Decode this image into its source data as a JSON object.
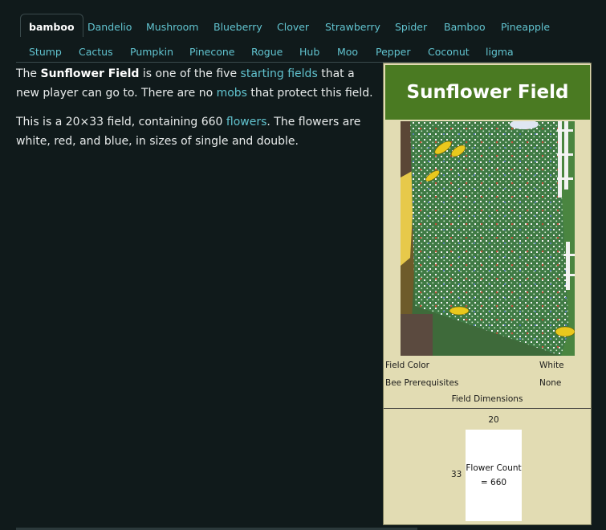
{
  "tabs_row1": [
    "bamboo",
    "Dandelio",
    "Mushroom",
    "Blueberry",
    "Clover",
    "Strawberry",
    "Spider",
    "Bamboo",
    "Pineapple"
  ],
  "tabs_row2": [
    "Stump",
    "Cactus",
    "Pumpkin",
    "Pinecone",
    "Rogue",
    "Hub",
    "Moo",
    "Pepper",
    "Coconut",
    "ligma"
  ],
  "active_tab": "bamboo",
  "article": {
    "p1_pre": "The ",
    "p1_bold": "Sunflower Field",
    "p1_mid": " is one of the five ",
    "p1_link1": "starting fields",
    "p1_mid2": " that a new player can go to. There are no ",
    "p1_link2": "mobs",
    "p1_post": " that protect this field.",
    "p2_pre": "This is a 20×33 field, containing 660 ",
    "p2_link": "flowers",
    "p2_post": ". The flowers are white, red, and blue, in sizes of single and double."
  },
  "infobox": {
    "title": "Sunflower Field",
    "rows": [
      {
        "label": "Field Color",
        "value": "White"
      },
      {
        "label": "Bee Prerequisites",
        "value": "None"
      }
    ],
    "dimensions_header": "Field Dimensions",
    "width": "20",
    "height": "33",
    "flower_count_label": "Flower Count",
    "flower_count_value": "= 660"
  },
  "colors": {
    "background": "#101a1b",
    "link": "#61c3cf",
    "infobox_bg": "#e2dcb3",
    "infobox_title_bg": "#4a7a22"
  }
}
